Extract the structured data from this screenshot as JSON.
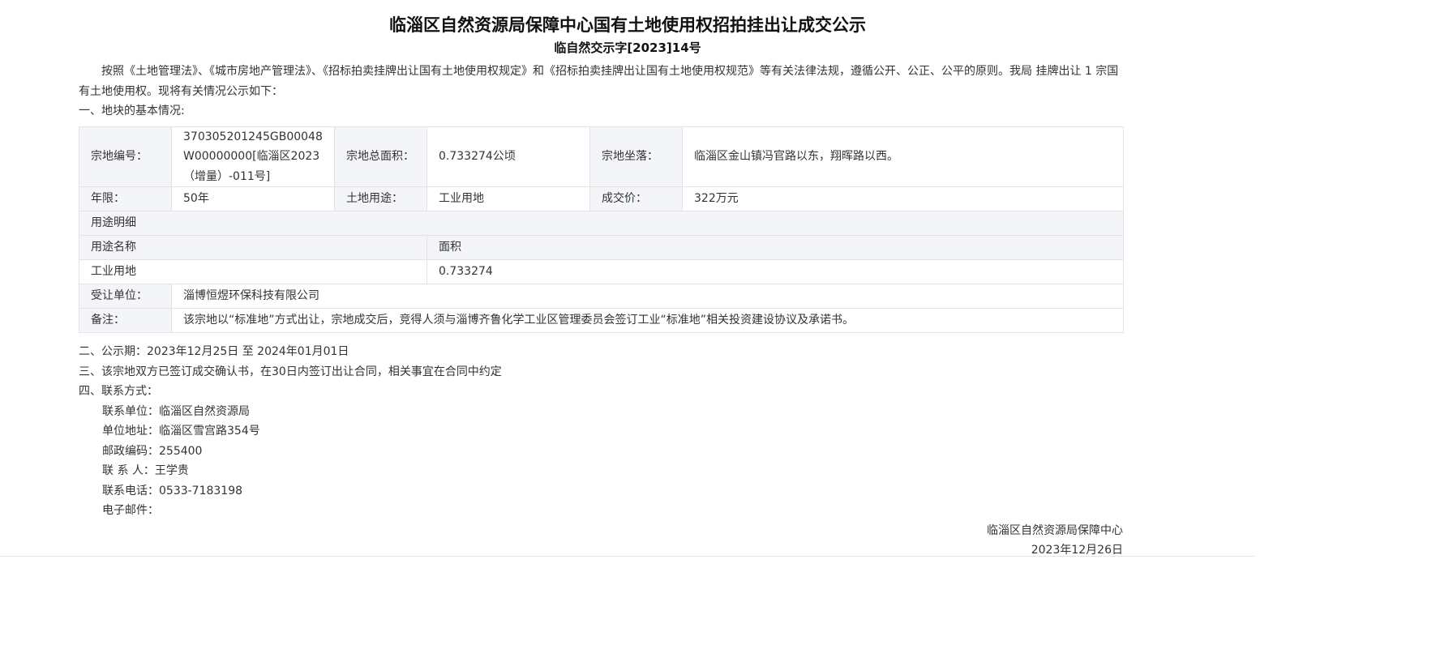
{
  "header": {
    "title": "临淄区自然资源局保障中心国有土地使用权招拍挂出让成交公示",
    "doc_number": "临自然交示字[2023]14号"
  },
  "intro": "按照《土地管理法》、《城市房地产管理法》、《招标拍卖挂牌出让国有土地使用权规定》和《招标拍卖挂牌出让国有土地使用权规范》等有关法律法规，遵循公开、公正、公平的原则。我局 挂牌出让 1 宗国有土地使用权。现将有关情况公示如下：",
  "section1_heading": "一、地块的基本情况:",
  "table": {
    "parcel_no_label": "宗地编号：",
    "parcel_no_value": "370305201245GB00048 W00000000[临淄区2023（增量）-011号]",
    "area_label": "宗地总面积：",
    "area_value": "0.733274公顷",
    "location_label": "宗地坐落：",
    "location_value": "临淄区金山镇冯官路以东，翔晖路以西。",
    "term_label": "年限：",
    "term_value": "50年",
    "use_label": "土地用途：",
    "use_value": "工业用地",
    "price_label": "成交价：",
    "price_value": "322万元",
    "use_detail_label": "用途明细",
    "use_name_header": "用途名称",
    "use_area_header": "面积",
    "use_name_value": "工业用地",
    "use_area_value": "0.733274",
    "grantee_label": "受让单位：",
    "grantee_value": "淄博恒煜环保科技有限公司",
    "remark_label": "备注：",
    "remark_value": "该宗地以“标准地”方式出让，宗地成交后，竞得人须与淄博齐鲁化学工业区管理委员会签订工业“标准地”相关投资建设协议及承诺书。"
  },
  "section2": "二、公示期：2023年12月25日 至 2024年01月01日",
  "section3": "三、该宗地双方已签订成交确认书，在30日内签订出让合同，相关事宜在合同中约定",
  "section4_heading": "四、联系方式：",
  "contact": {
    "unit": "联系单位：临淄区自然资源局",
    "address": "单位地址：临淄区雪宫路354号",
    "postcode": "邮政编码：255400",
    "person": "联 系 人：王学贵",
    "phone": "联系电话：0533-7183198",
    "email": "电子邮件："
  },
  "signature": {
    "org": "临淄区自然资源局保障中心",
    "date": "2023年12月26日"
  }
}
